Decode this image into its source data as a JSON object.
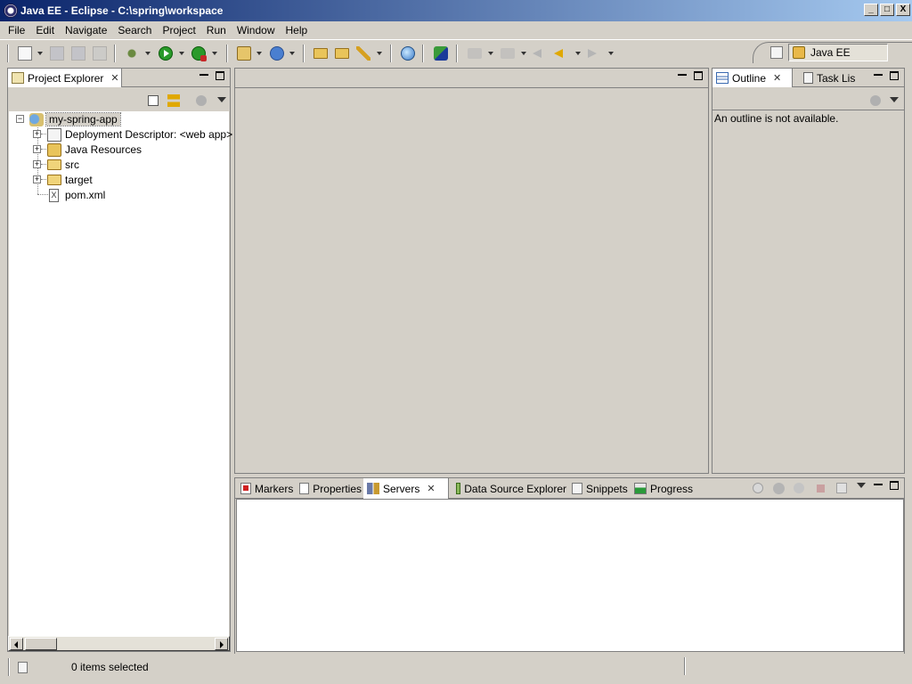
{
  "window": {
    "title": "Java EE - Eclipse - C:\\spring\\workspace",
    "controls": {
      "minimize": "_",
      "restore": "□",
      "close": "X"
    }
  },
  "menu": [
    "File",
    "Edit",
    "Navigate",
    "Search",
    "Project",
    "Run",
    "Window",
    "Help"
  ],
  "toolbar": {
    "icons": [
      "new-icon",
      "save-icon",
      "save-all-icon",
      "print-icon",
      "debug-icon",
      "run-icon",
      "external-tools-icon",
      "new-server-icon",
      "new-web-service-icon",
      "open-type-icon",
      "open-task-icon",
      "search-icon",
      "internal-web-browser-icon",
      "deploy-icon",
      "next-annotation-icon",
      "prev-annotation-icon",
      "last-edit-icon",
      "back-icon",
      "forward-icon"
    ]
  },
  "perspective": {
    "active": "Java EE"
  },
  "project_explorer": {
    "tab_label": "Project Explorer",
    "tree": [
      {
        "label": "my-spring-app",
        "level": 0,
        "expanded": true,
        "icon": "web-project-icon"
      },
      {
        "label": "Deployment Descriptor: <web app>",
        "level": 1,
        "expanded": false,
        "icon": "deployment-descriptor-icon"
      },
      {
        "label": "Java Resources",
        "level": 1,
        "expanded": false,
        "icon": "java-resources-icon"
      },
      {
        "label": "src",
        "level": 1,
        "expanded": false,
        "icon": "folder-icon"
      },
      {
        "label": "target",
        "level": 1,
        "expanded": false,
        "icon": "folder-icon"
      },
      {
        "label": "pom.xml",
        "level": 1,
        "expanded": null,
        "icon": "xml-file-icon"
      }
    ]
  },
  "outline": {
    "tabs": [
      "Outline",
      "Task Lis"
    ],
    "message": "An outline is not available."
  },
  "bottom_panel": {
    "tabs": [
      "Markers",
      "Properties",
      "Servers",
      "Data Source Explorer",
      "Snippets",
      "Progress"
    ],
    "active_tab": "Servers"
  },
  "status": {
    "text": "0 items selected"
  },
  "colors": {
    "title_start": "#0a246a",
    "title_end": "#a6caf0",
    "chrome": "#d4d0c8"
  }
}
